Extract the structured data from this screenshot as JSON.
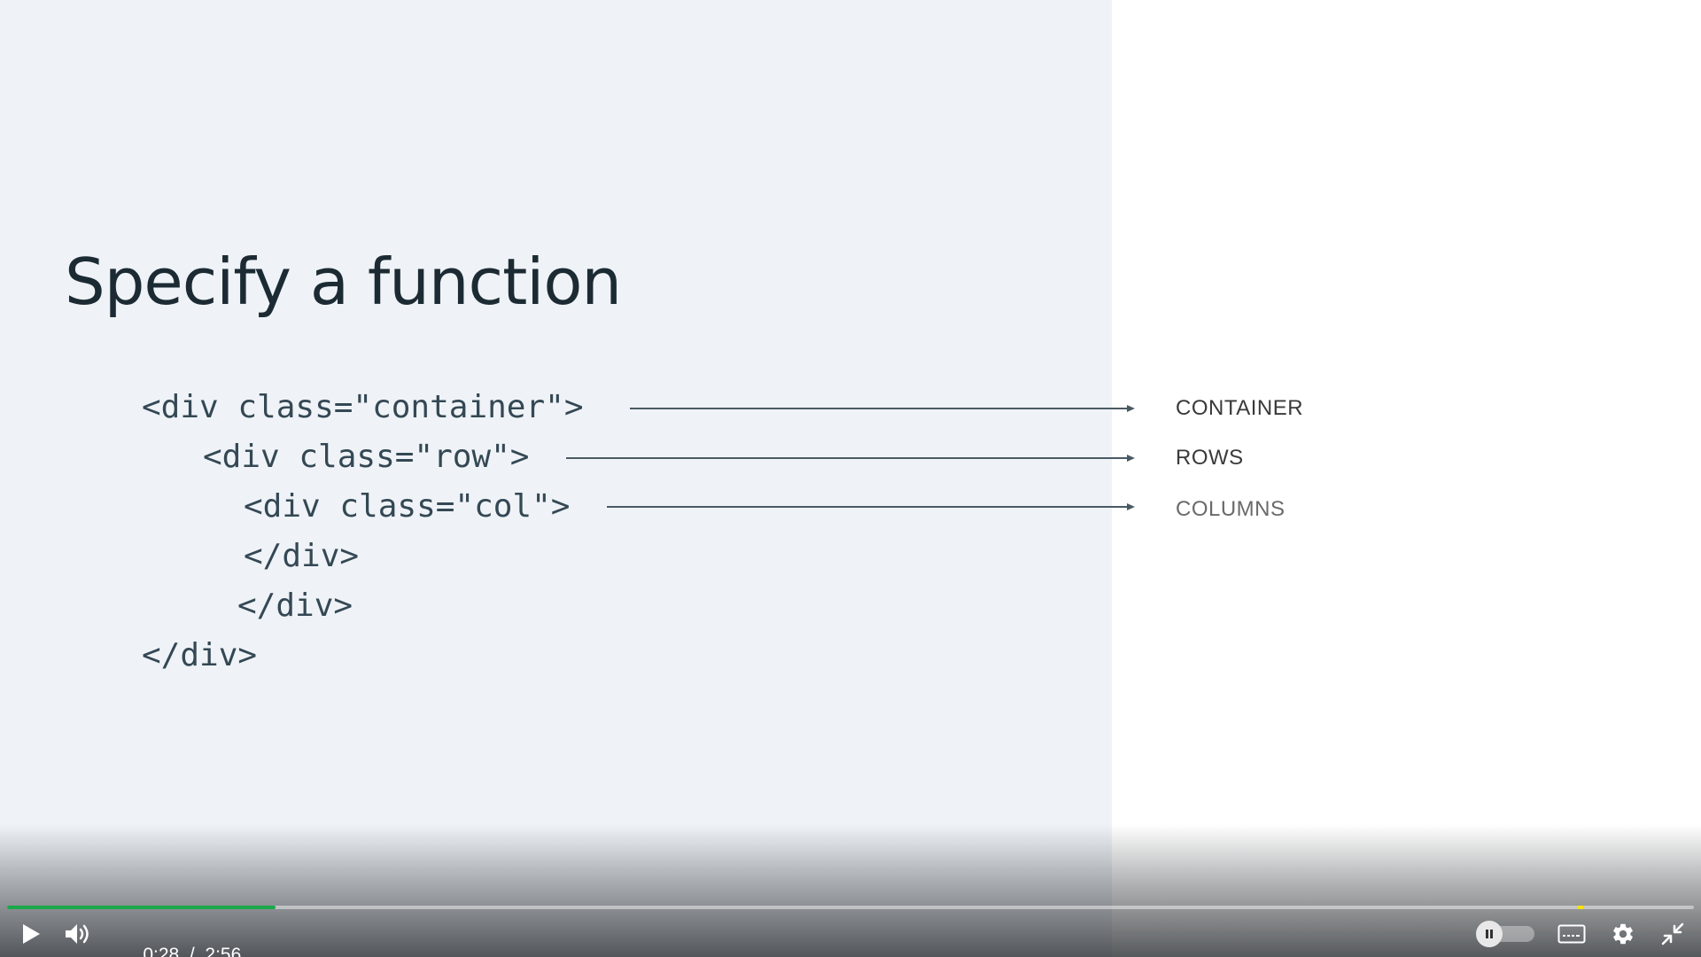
{
  "slide": {
    "title": "Specify a function",
    "code_lines": [
      "<div class=\"container\">",
      "<div class=\"row\">",
      "<div class=\"col\">",
      "</div>",
      "</div>",
      "</div>"
    ],
    "labels": {
      "container": "CONTAINER",
      "rows": "ROWS",
      "columns": "COLUMNS"
    }
  },
  "player": {
    "current_time": "0:28",
    "separator": "/",
    "duration": "2:56",
    "progress_fraction": 0.159,
    "icons": {
      "play": "play-icon",
      "volume": "volume-icon",
      "autoplay_toggle": "pause-toggle",
      "captions": "captions-icon",
      "settings": "gear-icon",
      "exit_fullscreen": "exit-fullscreen-icon"
    },
    "colors": {
      "progress": "#1aa84a",
      "marker": "#f5e50a"
    }
  }
}
